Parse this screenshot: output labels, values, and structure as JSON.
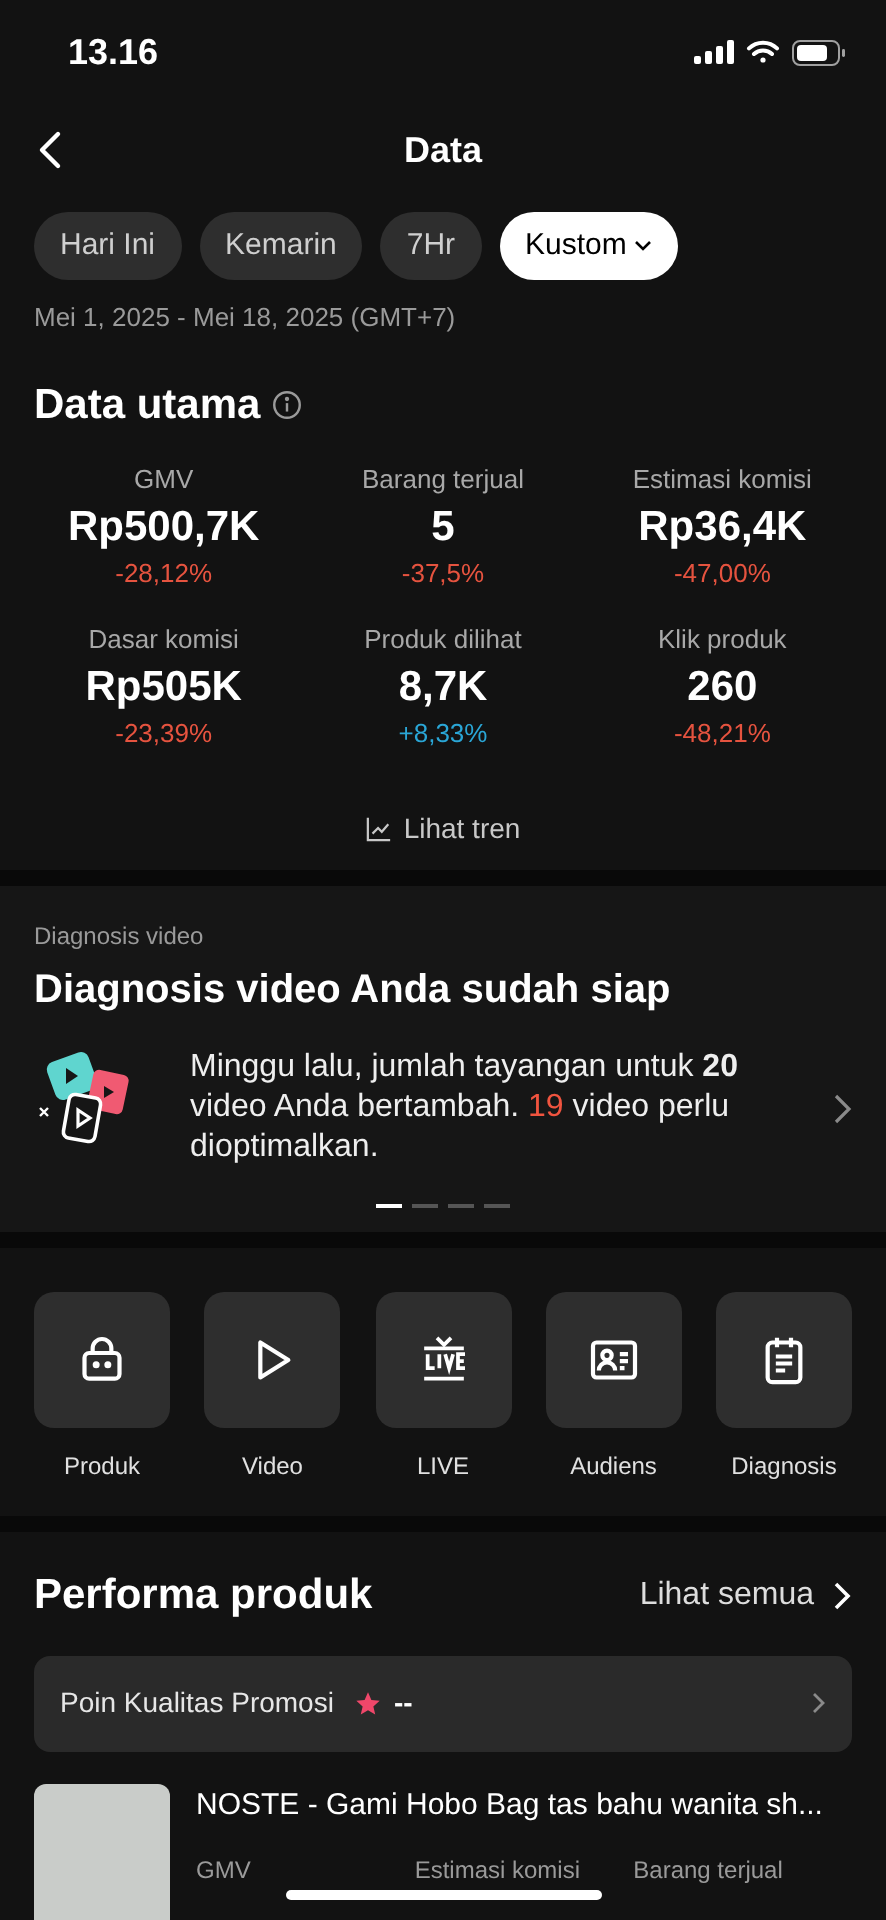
{
  "status_bar": {
    "time": "13.16"
  },
  "header": {
    "title": "Data"
  },
  "ranges": [
    {
      "label": "Hari Ini",
      "selected": false,
      "dropdown": false
    },
    {
      "label": "Kemarin",
      "selected": false,
      "dropdown": false
    },
    {
      "label": "7Hr",
      "selected": false,
      "dropdown": false
    },
    {
      "label": "Kustom",
      "selected": true,
      "dropdown": true
    }
  ],
  "date_range": "Mei 1, 2025 - Mei 18, 2025 (GMT+7)",
  "main_data": {
    "title": "Data utama",
    "metrics": [
      {
        "label": "GMV",
        "value": "Rp500,7K",
        "change": "-28,12%",
        "kind": "down"
      },
      {
        "label": "Barang terjual",
        "value": "5",
        "change": "-37,5%",
        "kind": "down"
      },
      {
        "label": "Estimasi komisi",
        "value": "Rp36,4K",
        "change": "-47,00%",
        "kind": "down"
      },
      {
        "label": "Dasar komisi",
        "value": "Rp505K",
        "change": "-23,39%",
        "kind": "down"
      },
      {
        "label": "Produk dilihat",
        "value": "8,7K",
        "change": "+8,33%",
        "kind": "up"
      },
      {
        "label": "Klik produk",
        "value": "260",
        "change": "-48,21%",
        "kind": "down"
      }
    ],
    "trend_link": "Lihat tren"
  },
  "diagnosis": {
    "label": "Diagnosis video",
    "title": "Diagnosis video Anda sudah siap",
    "message": [
      {
        "text": "Minggu lalu, jumlah tayangan untuk ",
        "kind": "plain"
      },
      {
        "text": "20",
        "kind": "bold"
      },
      {
        "text": " video Anda bertambah. ",
        "kind": "plain"
      },
      {
        "text": "19",
        "kind": "alert"
      },
      {
        "text": " video perlu dioptimalkan.",
        "kind": "plain"
      }
    ],
    "pages": [
      {
        "selected": true
      },
      {
        "selected": false
      },
      {
        "selected": false
      },
      {
        "selected": false
      }
    ]
  },
  "shortcuts": [
    {
      "label": "Produk",
      "kind": "bag"
    },
    {
      "label": "Video",
      "kind": "play"
    },
    {
      "label": "LIVE",
      "kind": "live"
    },
    {
      "label": "Audiens",
      "kind": "audience"
    },
    {
      "label": "Diagnosis",
      "kind": "clipboard"
    }
  ],
  "product_performance": {
    "title": "Performa produk",
    "see_all": "Lihat semua",
    "promo_score": {
      "label": "Poin Kualitas Promosi",
      "value": "--"
    },
    "product": {
      "name": "NOSTE - Gami Hobo Bag tas bahu wanita sh...",
      "columns": [
        "GMV",
        "Estimasi komisi",
        "Barang terjual"
      ]
    }
  }
}
